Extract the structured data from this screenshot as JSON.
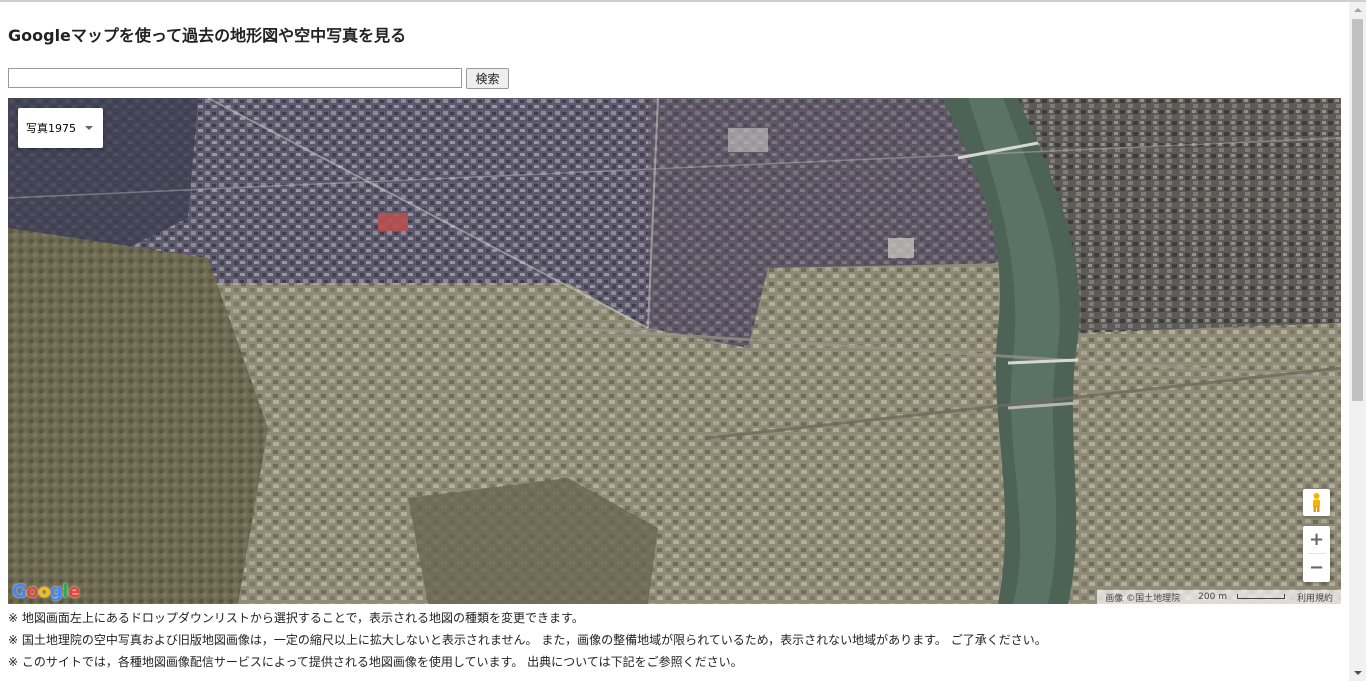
{
  "page": {
    "title": "Googleマップを使って過去の地形図や空中写真を見る"
  },
  "search": {
    "value": "",
    "placeholder": "",
    "button_label": "検索"
  },
  "map": {
    "type_selector": {
      "selected": "写真1975"
    },
    "controls": {
      "zoom_in": "+",
      "zoom_out": "−",
      "pegman_icon": "street-view-pegman-icon"
    },
    "logo": "Google",
    "attribution": {
      "imagery": "画像 ©国土地理院",
      "scale": "200 m",
      "terms": "利用規約"
    }
  },
  "notes": [
    "※ 地図画面左上にあるドロップダウンリストから選択することで，表示される地図の種類を変更できます。",
    "※ 国土地理院の空中写真および旧版地図画像は，一定の縮尺以上に拡大しないと表示されません。 また，画像の整備地域が限られているため，表示されない地域があります。 ご了承ください。",
    "※ このサイトでは，各種地図画像配信サービスによって提供される地図画像を使用しています。 出典については下記をご参照ください。"
  ],
  "colors": {
    "logo_blue": "#4285F4",
    "logo_red": "#EA4335",
    "logo_yellow": "#FBBC05",
    "logo_green": "#34A853",
    "pegman": "#F4B400"
  }
}
